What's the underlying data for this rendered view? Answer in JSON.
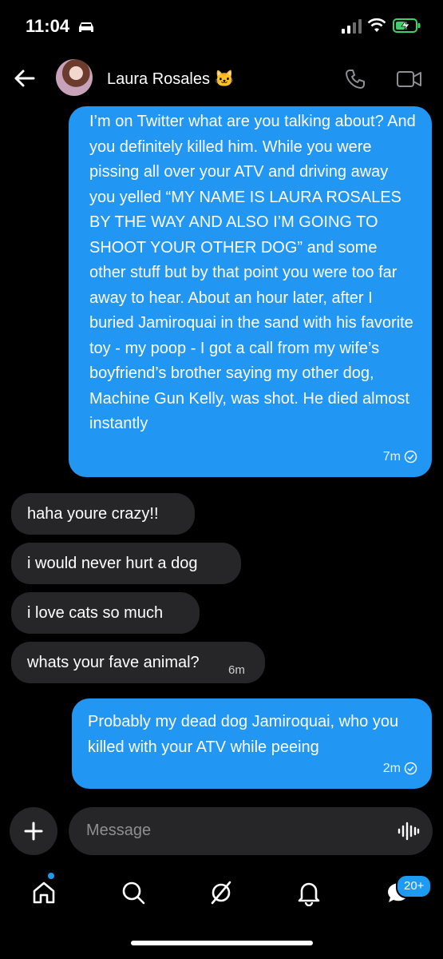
{
  "status_bar": {
    "time": "11:04"
  },
  "header": {
    "contact_name": "Laura Rosales 🐱"
  },
  "messages": [
    {
      "direction": "outgoing",
      "text": "I’m on Twitter what are you talking about? And you definitely killed him. While you were pissing all over your ATV and driving away you yelled “MY NAME IS LAURA ROSALES BY THE WAY AND ALSO I’M GOING TO SHOOT YOUR OTHER DOG” and some other stuff but by that point you were too far away to hear. About an hour later, after I buried Jamiroquai in the sand with his favorite toy - my poop - I got a call from my wife’s boyfriend’s brother saying my other dog, Machine Gun Kelly, was shot. He died almost instantly",
      "time": "7m"
    },
    {
      "direction": "incoming",
      "text": "haha youre crazy!!"
    },
    {
      "direction": "incoming",
      "text": "i would never hurt a dog"
    },
    {
      "direction": "incoming",
      "text": "i love cats so much"
    },
    {
      "direction": "incoming",
      "text": "whats your fave animal?",
      "time": "6m"
    },
    {
      "direction": "outgoing",
      "text": "Probably my dead dog Jamiroquai, who you killed with your ATV while peeing",
      "time": "2m"
    }
  ],
  "composer": {
    "placeholder": "Message"
  },
  "tabbar": {
    "messages_badge": "20+"
  },
  "colors": {
    "accent": "#1d9bf0",
    "outgoing_bubble": "#2196f3",
    "incoming_bubble": "#262628",
    "background": "#000000"
  }
}
